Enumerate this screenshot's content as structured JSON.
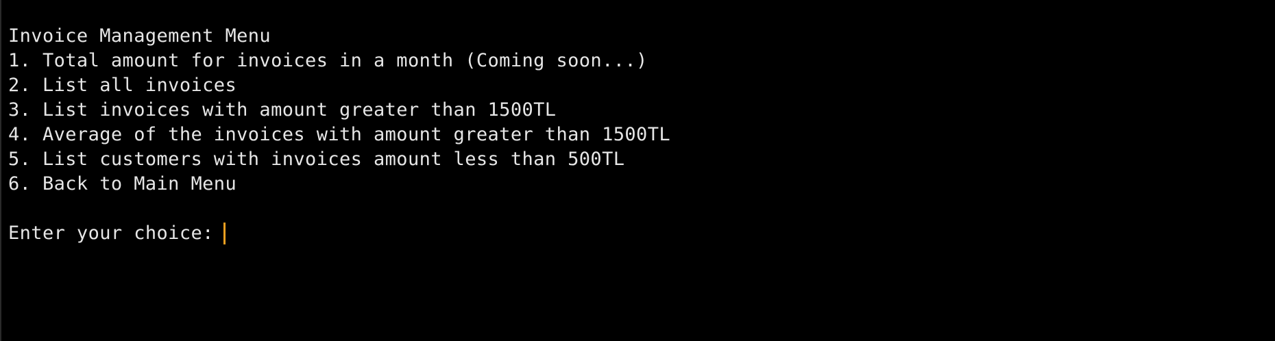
{
  "terminal": {
    "title": "Invoice Management Menu",
    "options": [
      "1. Total amount for invoices in a month (Coming soon...)",
      "2. List all invoices",
      "3. List invoices with amount greater than 1500TL",
      "4. Average of the invoices with amount greater than 1500TL",
      "5. List customers with invoices amount less than 500TL",
      "6. Back to Main Menu"
    ],
    "prompt": "Enter your choice:",
    "input_value": "",
    "colors": {
      "background": "#000000",
      "text": "#e6e6e6",
      "cursor": "#f0a020"
    }
  }
}
